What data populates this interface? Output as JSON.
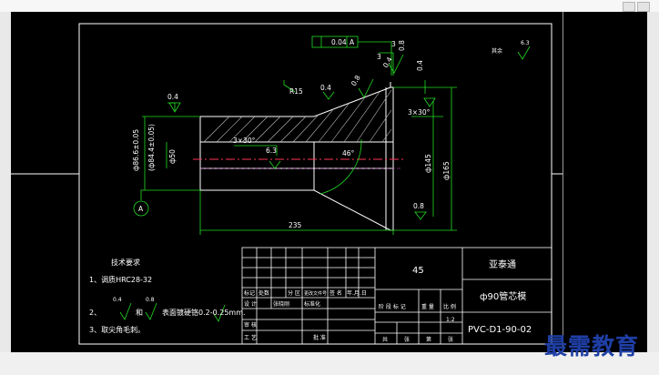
{
  "drawing": {
    "roughness_general": "其余",
    "roughness_general_value": "6.3",
    "tolerance_value": "0.04",
    "tolerance_datum": "A",
    "radius_label": "R15",
    "chamfer_right": "3×30°",
    "chamfer_left": "3×30°",
    "angle_label": "46°",
    "length_dim": "235",
    "dia_outer_left": "ф86.6±0.05",
    "dia_outer_left_paren": "(ф84.4±0.05)",
    "dia_bore": "ф50",
    "dia_right_a": "ф165",
    "dia_right_b": "ф145",
    "datum_bubble": "A",
    "rough_vals": [
      "0.8",
      "0.4",
      "0.4",
      "3",
      "3",
      "0.8",
      "0.8",
      "0.4",
      "0.4",
      "6.3"
    ]
  },
  "notes": {
    "title": "技术要求",
    "line1": "1、调质HRC28-32",
    "line2_prefix": "2、",
    "line2_and": "和",
    "line2_suffix": "表面镀硬铬0.2-0.25mm.",
    "line2_sym1": "0.4",
    "line2_sym2": "0.8",
    "line3": "3、取尖角毛刺。"
  },
  "title_block": {
    "material": "45",
    "company": "亚泰通",
    "part_name": "ф90管芯模",
    "drawing_no": "PVC-D1-90-02",
    "scale": "1:2",
    "rev_headers": [
      "标记",
      "处数",
      "分 区",
      "更改文件号",
      "签 名",
      "年.月.日"
    ],
    "row_design": [
      "设 计",
      "张晓刚",
      "标准化"
    ],
    "stage_headers": [
      "阶 段 标 记",
      "重 量",
      "比 例"
    ],
    "row_review": "审 核",
    "row_process": "工 艺",
    "approve": "批 准",
    "sheet_info": [
      "共",
      "张",
      "第",
      "张"
    ]
  },
  "watermark": "最需教育"
}
